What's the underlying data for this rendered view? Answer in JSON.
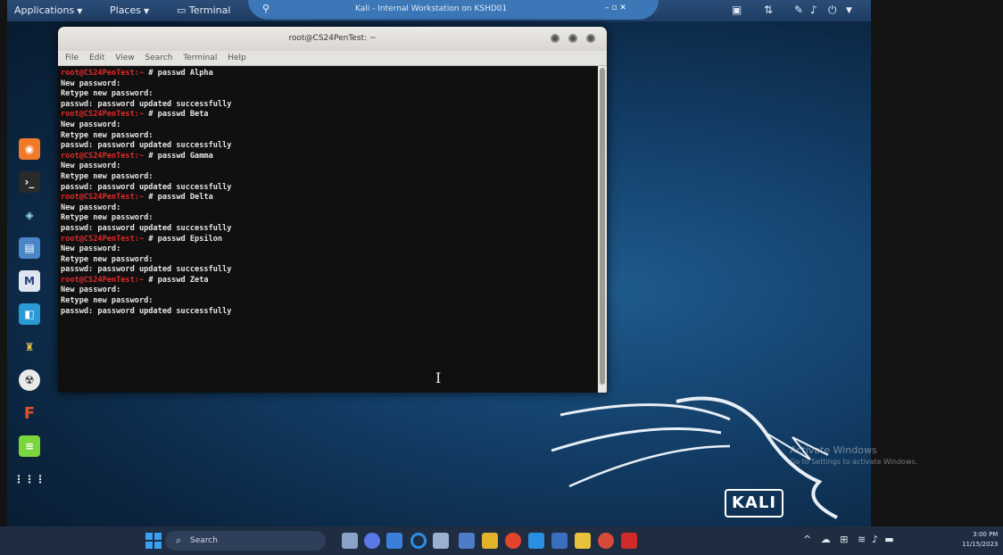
{
  "top_panel": {
    "applications": "Applications",
    "places": "Places",
    "terminal": "Terminal",
    "vm_title": "Kali - Internal Workstation on KSHD01"
  },
  "terminal": {
    "title": "root@CS24PenTest: ~",
    "menu": [
      "File",
      "Edit",
      "View",
      "Search",
      "Terminal",
      "Help"
    ],
    "prompt": "root@CS24PenTest:~",
    "lines": [
      {
        "prompt": true,
        "text": " # passwd Alpha"
      },
      {
        "prompt": false,
        "text": "New password:"
      },
      {
        "prompt": false,
        "text": "Retype new password:"
      },
      {
        "prompt": false,
        "text": "passwd: password updated successfully"
      },
      {
        "prompt": true,
        "text": " # passwd Beta"
      },
      {
        "prompt": false,
        "text": "New password:"
      },
      {
        "prompt": false,
        "text": "Retype new password:"
      },
      {
        "prompt": false,
        "text": "passwd: password updated successfully"
      },
      {
        "prompt": true,
        "text": " # passwd Gamma"
      },
      {
        "prompt": false,
        "text": "New password:"
      },
      {
        "prompt": false,
        "text": "Retype new password:"
      },
      {
        "prompt": false,
        "text": "passwd: password updated successfully"
      },
      {
        "prompt": true,
        "text": " # passwd Delta"
      },
      {
        "prompt": false,
        "text": "New password:"
      },
      {
        "prompt": false,
        "text": "Retype new password:"
      },
      {
        "prompt": false,
        "text": "passwd: password updated successfully"
      },
      {
        "prompt": true,
        "text": " # passwd Epsilon"
      },
      {
        "prompt": false,
        "text": "New password:"
      },
      {
        "prompt": false,
        "text": "Retype new password:"
      },
      {
        "prompt": false,
        "text": "passwd: password updated successfully"
      },
      {
        "prompt": true,
        "text": " # passwd Zeta"
      },
      {
        "prompt": false,
        "text": "New password:"
      },
      {
        "prompt": false,
        "text": "Retype new password:"
      },
      {
        "prompt": false,
        "text": "passwd: password updated successfully"
      }
    ]
  },
  "desktop": {
    "kali_logo": "KALI",
    "activate_title": "Activate Windows",
    "activate_sub": "Go to Settings to activate Windows."
  },
  "taskbar": {
    "search_placeholder": "Search",
    "time": "3:00 PM",
    "date": "11/15/2023"
  },
  "colors": {
    "prompt": "#e02b2b",
    "desktop": "#123d66",
    "taskbar": "#1f2d42"
  }
}
